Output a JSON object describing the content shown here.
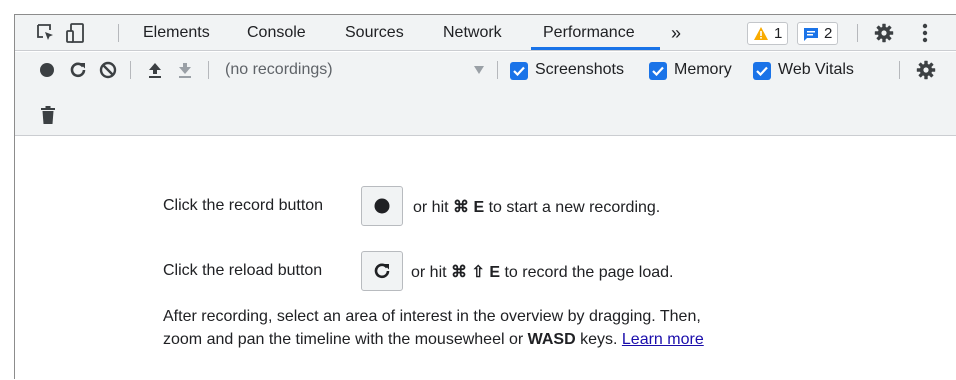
{
  "tabs": {
    "items": [
      {
        "label": "Elements"
      },
      {
        "label": "Console"
      },
      {
        "label": "Sources"
      },
      {
        "label": "Network"
      },
      {
        "label": "Performance"
      }
    ],
    "more": "»",
    "warnings_count": "1",
    "messages_count": "2"
  },
  "toolbar": {
    "recordings_select": "(no recordings)",
    "screenshots_label": "Screenshots",
    "memory_label": "Memory",
    "web_vitals_label": "Web Vitals",
    "screenshots_checked": true,
    "memory_checked": true,
    "web_vitals_checked": true
  },
  "instructions": {
    "record_prefix": "Click the record button",
    "record_hint_prefix": "or hit",
    "record_shortcut": "⌘ E",
    "record_suffix": "to start a new recording.",
    "reload_prefix": "Click the reload button",
    "reload_hint_prefix": "or hit",
    "reload_shortcut": "⌘ ⇧ E",
    "reload_suffix": "to record the page load.",
    "after_line1": "After recording, select an area of interest in the overview by dragging. Then,",
    "after_line2_prefix": "zoom and pan the timeline with the mousewheel or",
    "after_keys": "WASD",
    "after_line2_suffix": "keys.",
    "learn_more": "Learn more"
  },
  "colors": {
    "accent": "#1a73e8",
    "warning": "#f9ab00",
    "toolbar_bg": "#f1f3f4",
    "link": "#1a0dab"
  }
}
